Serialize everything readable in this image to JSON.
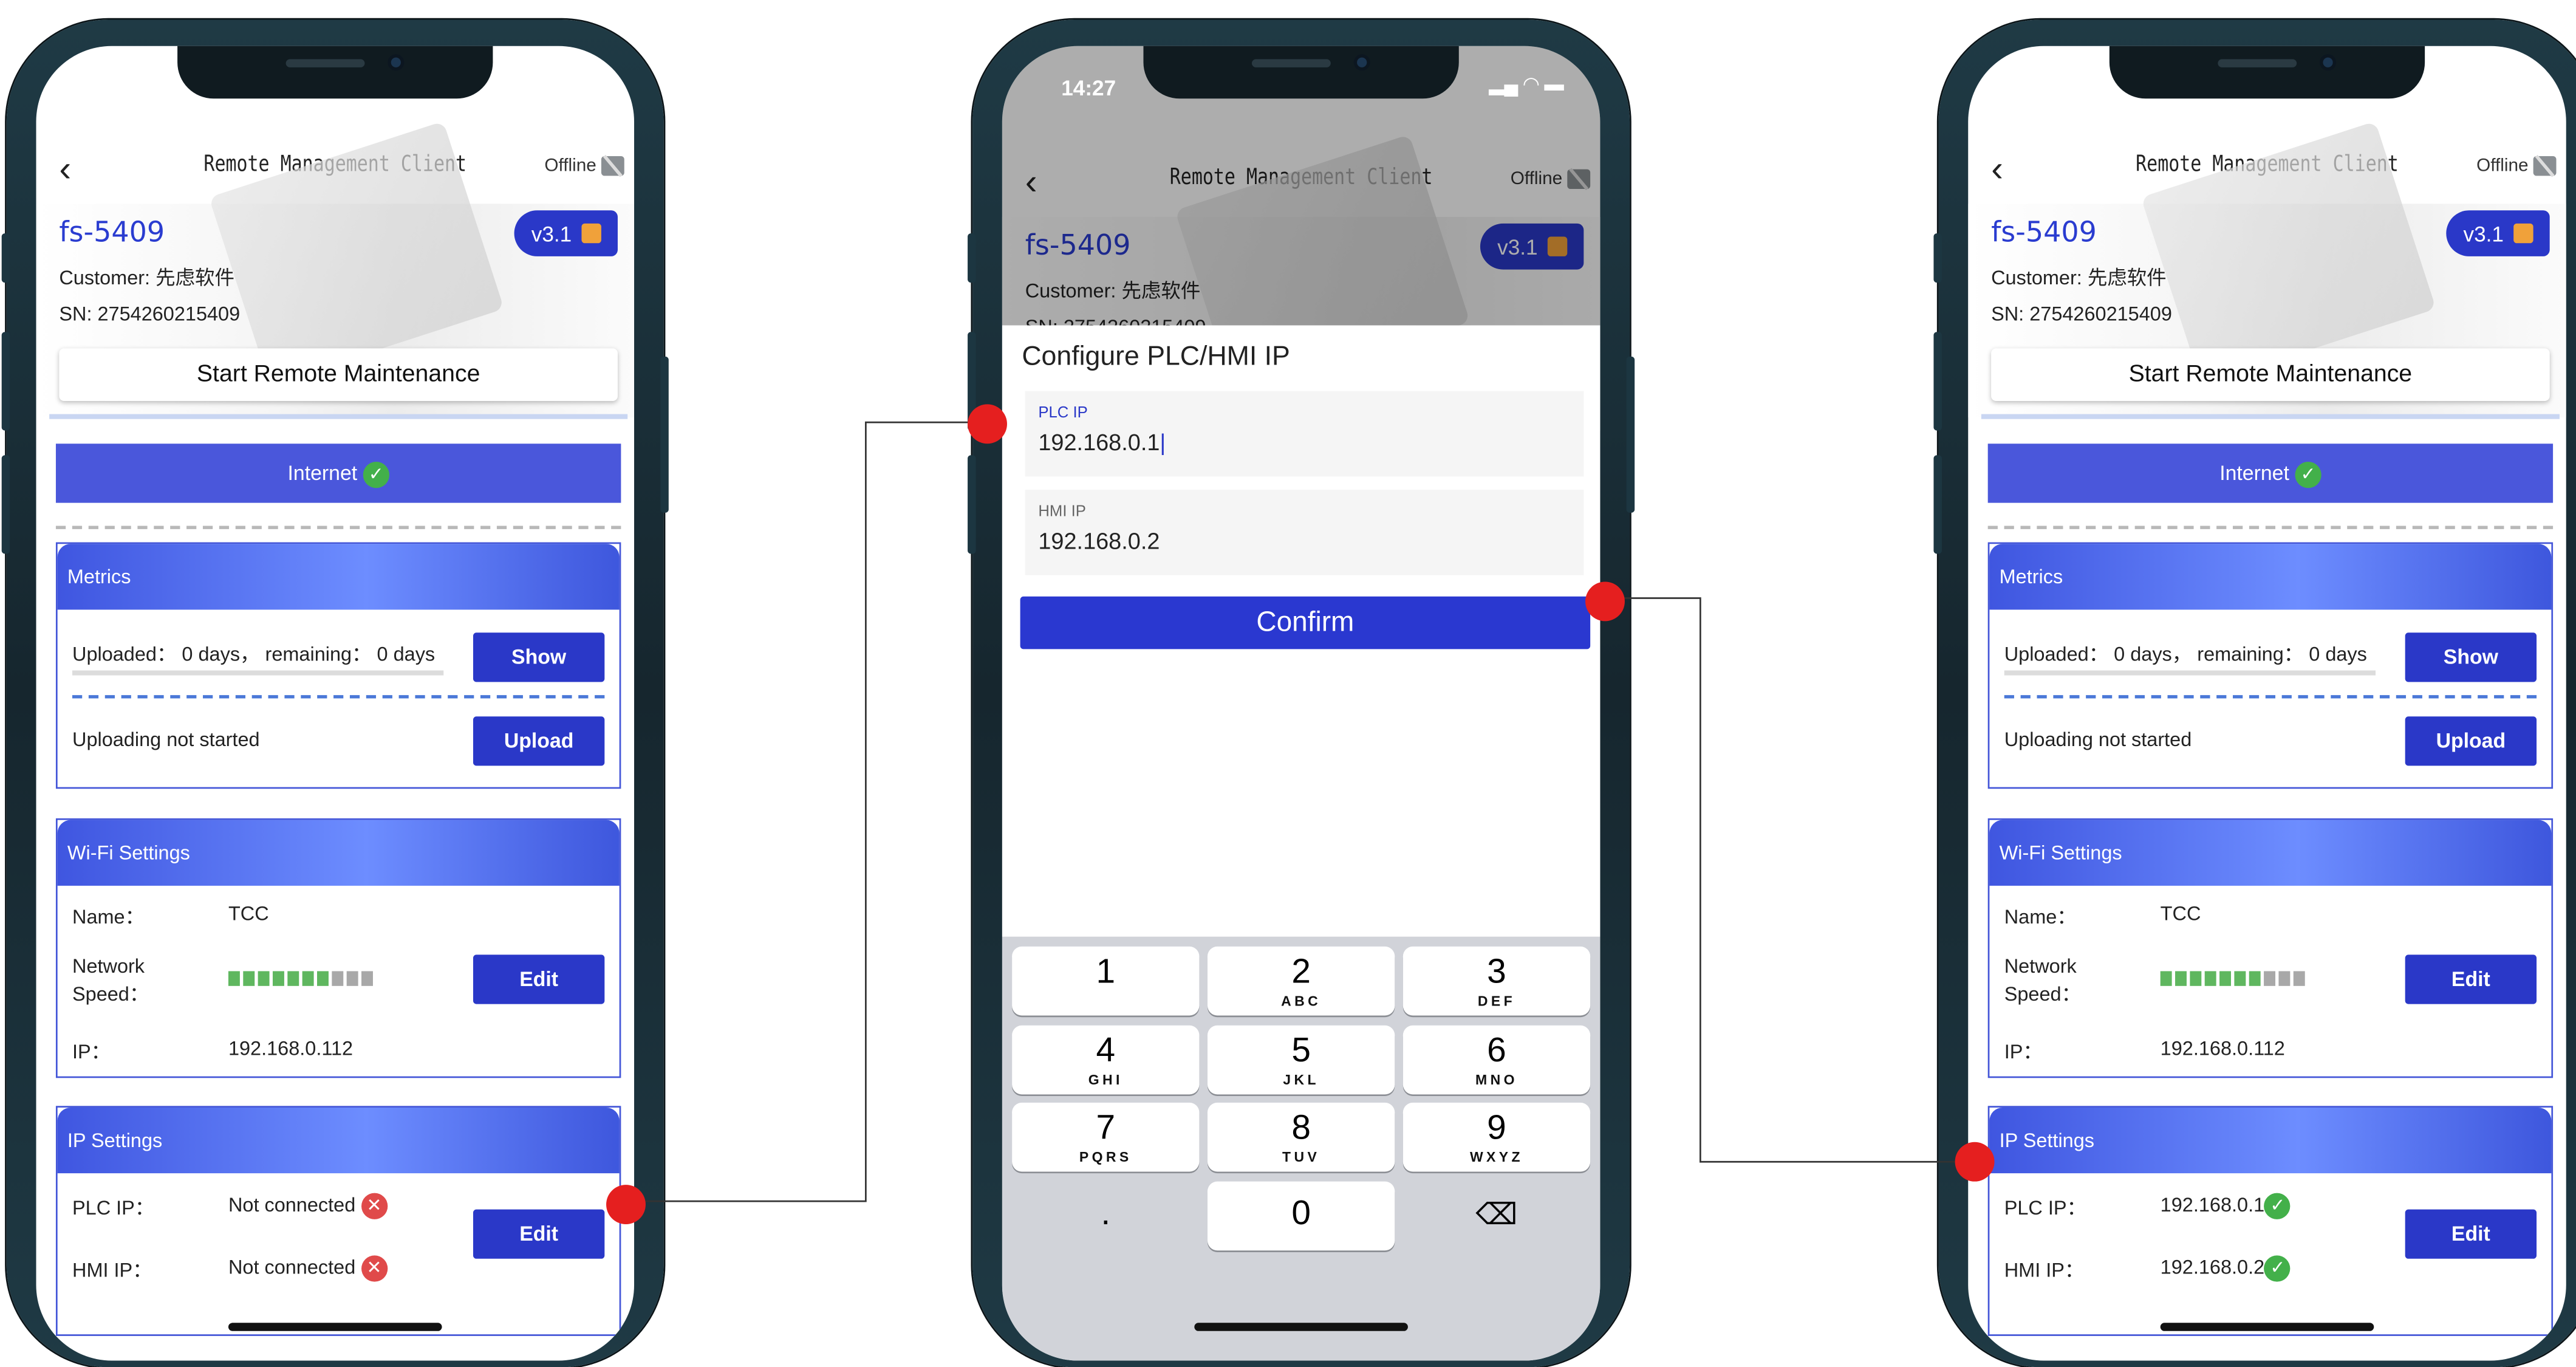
{
  "app": {
    "title": "Remote Management Client",
    "offline_label": "Offline",
    "status_time": "14:27",
    "device_name": "fs-5409",
    "version": "v3.1",
    "customer": "Customer: 先虑软件",
    "sn": "SN: 2754260215409",
    "sn_partial": "SN: 2754260215409",
    "remote_button": "Start Remote Maintenance",
    "internet_label": "Internet"
  },
  "metrics": {
    "header": "Metrics",
    "uploaded_text": "Uploaded： 0 days， remaining： 0 days",
    "show_button": "Show",
    "upload_status": "Uploading not started",
    "upload_button": "Upload"
  },
  "wifi": {
    "header": "Wi-Fi Settings",
    "name_label": "Name：",
    "name_value": "TCC",
    "speed_label_1": "Network",
    "speed_label_2": "Speed：",
    "signal_level": 0.7,
    "edit_button": "Edit",
    "ip_label": "IP：",
    "ip_value": "192.168.0.112"
  },
  "ip_settings": {
    "header": "IP Settings",
    "plc_label": "PLC IP：",
    "hmi_label": "HMI IP：",
    "edit_button": "Edit",
    "before": {
      "plc_value": "Not connected",
      "hmi_value": "Not connected"
    },
    "after": {
      "plc_value": "192.168.0.1",
      "hmi_value": "192.168.0.2"
    }
  },
  "dialog": {
    "title": "Configure PLC/HMI IP",
    "plc_label": "PLC IP",
    "plc_value": "192.168.0.1",
    "hmi_label": "HMI IP",
    "hmi_value": "192.168.0.2",
    "confirm_button": "Confirm"
  },
  "keypad": {
    "keys": [
      {
        "num": "1",
        "letters": ""
      },
      {
        "num": "2",
        "letters": "ABC"
      },
      {
        "num": "3",
        "letters": "DEF"
      },
      {
        "num": "4",
        "letters": "GHI"
      },
      {
        "num": "5",
        "letters": "JKL"
      },
      {
        "num": "6",
        "letters": "MNO"
      },
      {
        "num": "7",
        "letters": "PQRS"
      },
      {
        "num": "8",
        "letters": "TUV"
      },
      {
        "num": "9",
        "letters": "WXYZ"
      }
    ],
    "dot_key": ".",
    "zero_key": "0",
    "delete_icon": "backspace-icon"
  },
  "colors": {
    "accent": "#2a38c8",
    "marker": "#e51f1f",
    "ok": "#43b04a",
    "error": "#e04a4a"
  }
}
